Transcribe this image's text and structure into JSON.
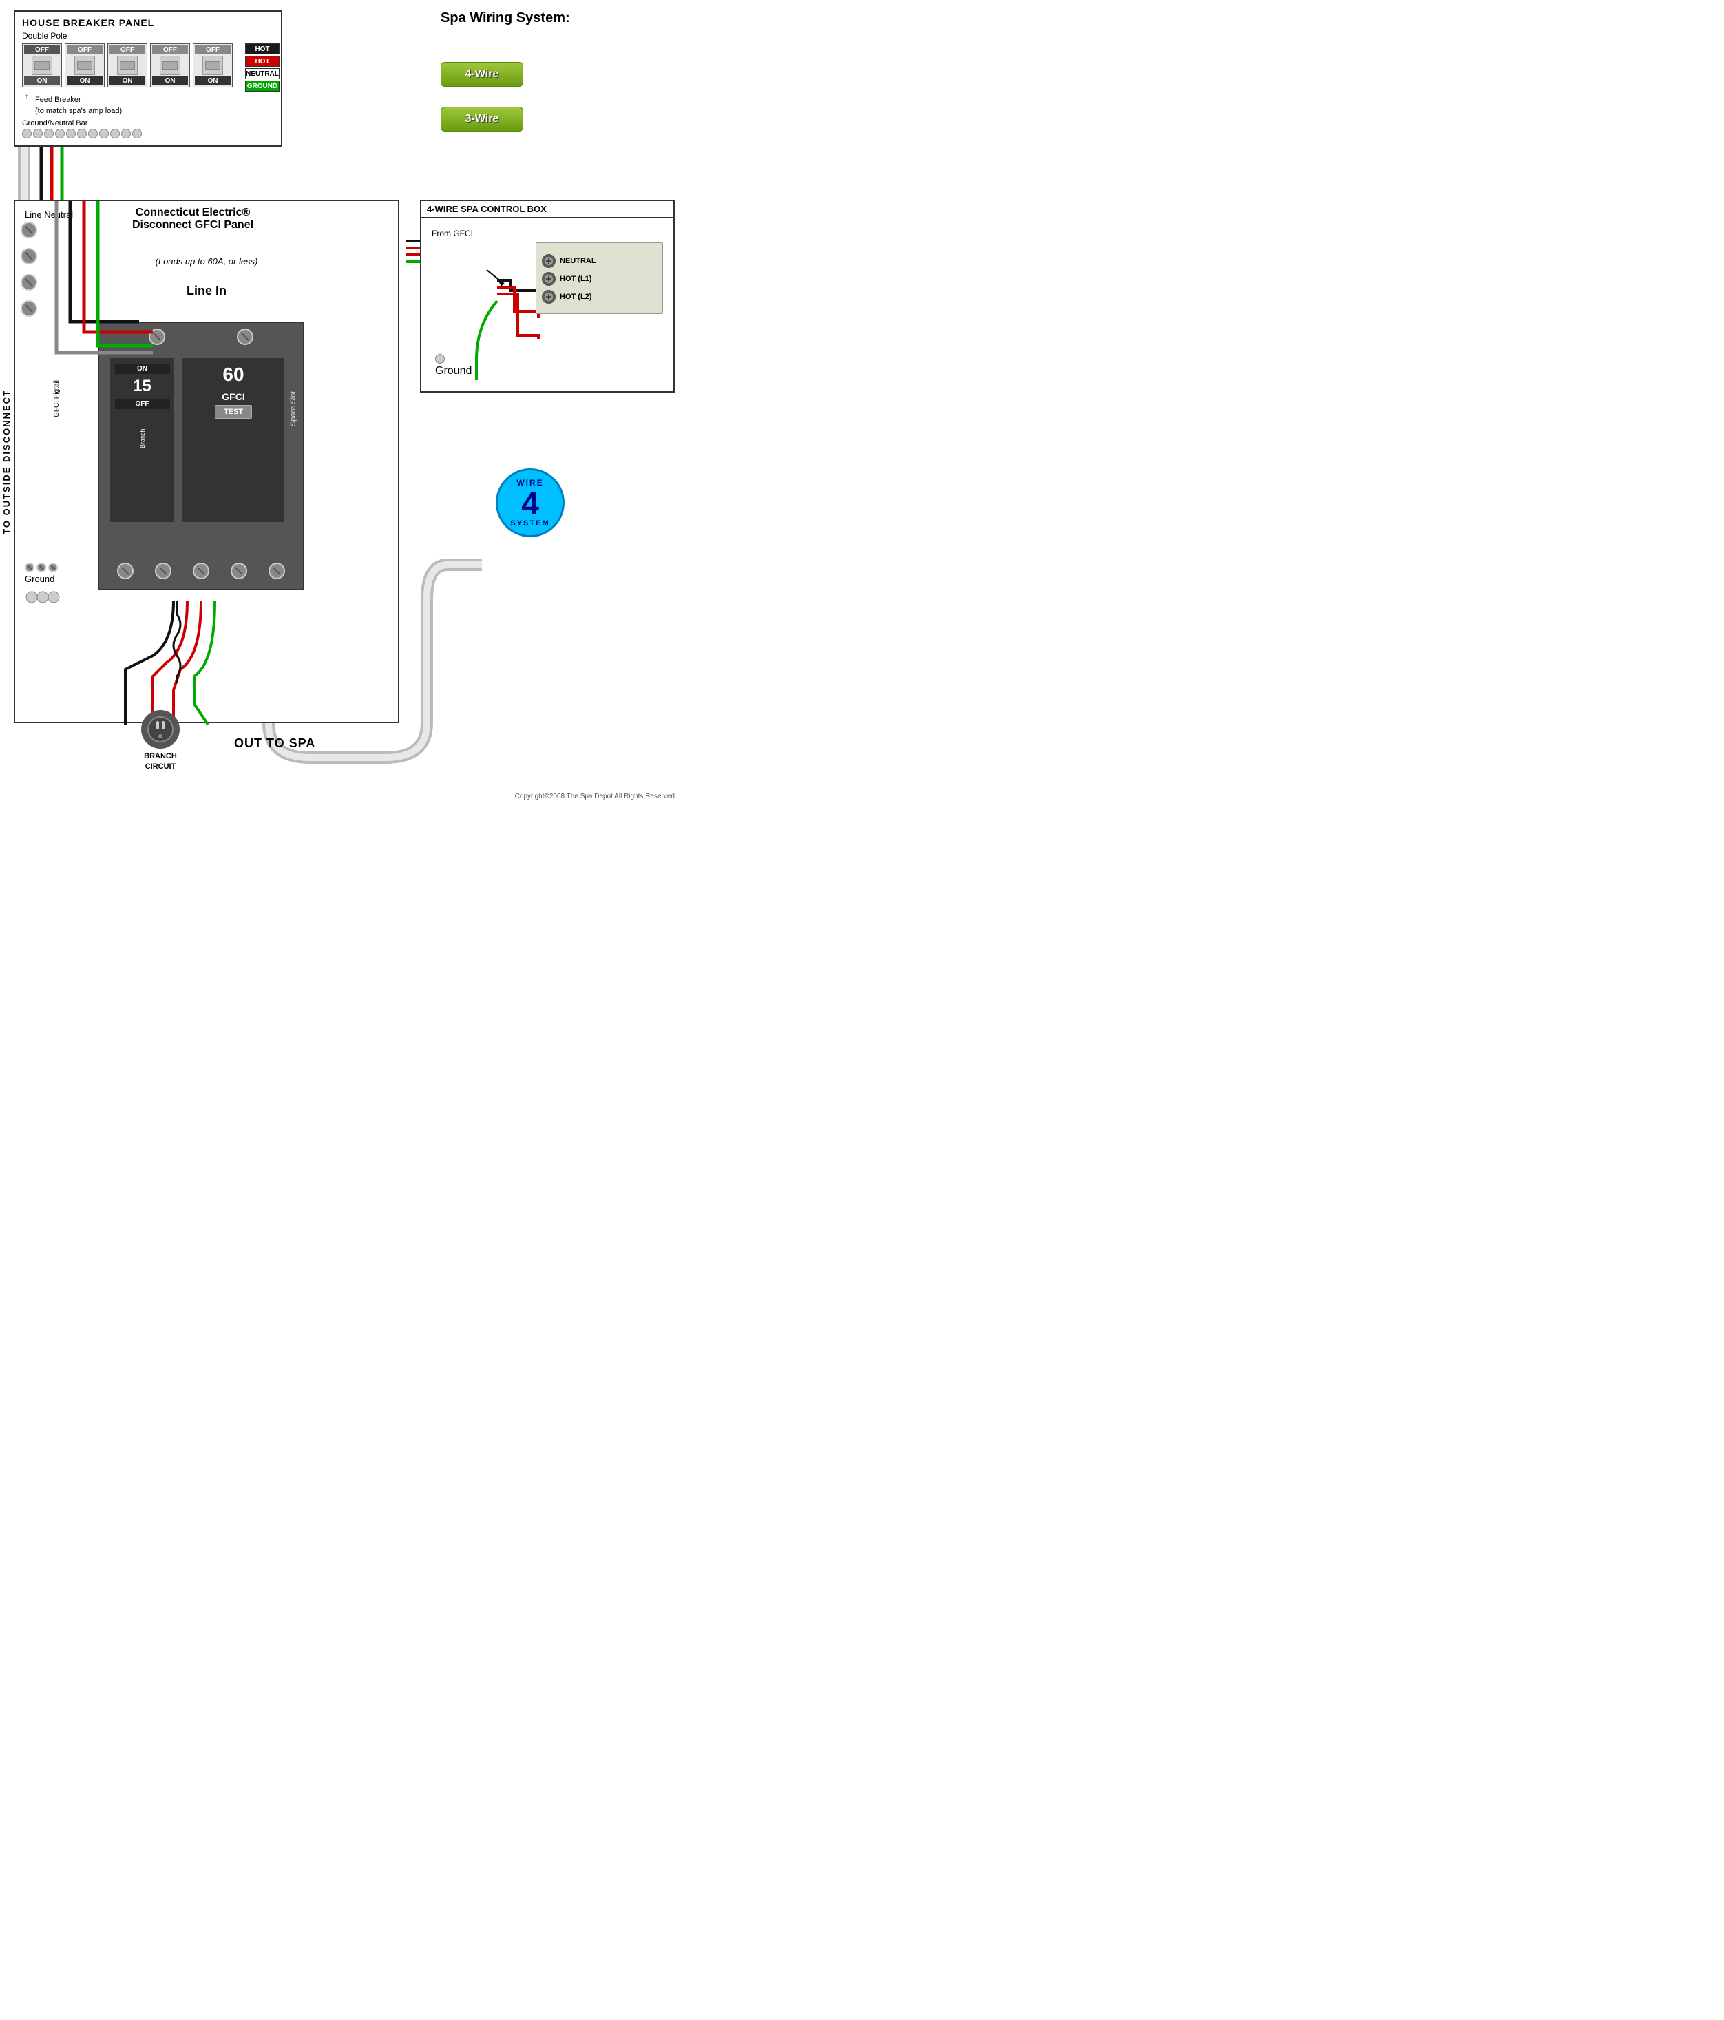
{
  "housePanelTitle": "HOUSE BREAKER PANEL",
  "doublePoleLabel": "Double Pole",
  "breakers": [
    {
      "off": "OFF",
      "on": "ON",
      "isFirst": true
    },
    {
      "off": "OFF",
      "on": "ON",
      "isFirst": false
    },
    {
      "off": "OFF",
      "on": "ON",
      "isFirst": false
    },
    {
      "off": "OFF",
      "on": "ON",
      "isFirst": false
    },
    {
      "off": "OFF",
      "on": "ON",
      "isFirst": false
    }
  ],
  "legend": {
    "hot1Label": "HOT",
    "hot2Label": "HOT",
    "neutralLabel": "NEUTRAL",
    "groundLabel": "GROUND"
  },
  "feedBreakerLabel": "Feed Breaker",
  "feedBreakerSub": "(to match spa's amp load)",
  "groundNeutralBar": "Ground/Neutral Bar",
  "spaWiringTitle": "Spa Wiring System:",
  "wire4BtnLabel": "4-Wire",
  "wire3BtnLabel": "3-Wire",
  "gfciPanelTitle": "Connecticut Electric®\nDisconnect GFCI Panel",
  "lineNeutralLabel": "Line Neutral",
  "loadsLabel": "(Loads up to 60A, or less)",
  "lineInLabel": "Line In",
  "branch15Label": "15",
  "branchOnLabel": "ON",
  "branchOffLabel": "OFF",
  "branchLabel": "Branch",
  "gfci60Label": "60",
  "gfciLabel": "GFCI",
  "testLabel": "TEST",
  "spareSlotLabel": "Spare Slot",
  "gfciPigtailLabel": "GFCI Pigtail",
  "groundMainLabel": "Ground",
  "toOutsideLabel": "TO OUTSIDE DISCONNECT",
  "branchCircuitLabel": "BRANCH\nCIRCUIT",
  "outToSpaLabel": "OUT TO SPA",
  "spaControlTitle": "4-WIRE SPA CONTROL BOX",
  "fromGfciLabel": "From GFCI",
  "terminals": [
    {
      "label": "NEUTRAL"
    },
    {
      "label": "HOT (L1)"
    },
    {
      "label": "HOT (L2)"
    }
  ],
  "spaGroundLabel": "Ground",
  "wire4Badge": {
    "wire": "WIRE",
    "number": "4",
    "system": "SYSTEM"
  },
  "copyright": "Copyright©2008 The Spa Depot All Rights Reserved"
}
